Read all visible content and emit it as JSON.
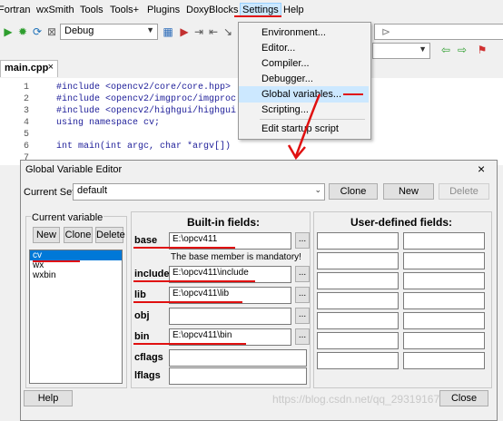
{
  "menubar": {
    "items": [
      "Fortran",
      "wxSmith",
      "Tools",
      "Tools+",
      "Plugins",
      "DoxyBlocks",
      "Settings",
      "Help"
    ]
  },
  "toolbar": {
    "build_target": "Debug"
  },
  "editor": {
    "tab_label": "main.cpp",
    "tab_close": "×",
    "line_numbers": [
      "1",
      "2",
      "3",
      "4",
      "5",
      "6",
      "7"
    ],
    "lines": [
      "#include <opencv2/core/core.hpp>",
      "#include <opencv2/imgproc/imgproc",
      "#include <opencv2/highgui/highgui",
      "using namespace cv;",
      "",
      "int main(int argc, char *argv[])",
      ""
    ]
  },
  "settings_menu": {
    "items": [
      "Environment...",
      "Editor...",
      "Compiler...",
      "Debugger...",
      "Global variables...",
      "Scripting...",
      "Edit startup script"
    ]
  },
  "dialog": {
    "title": "Global Variable Editor",
    "close": "×",
    "current_set_label": "Current Set:",
    "current_set_value": "default",
    "clone_set": "Clone",
    "new_set": "New",
    "delete_set": "Delete",
    "current_variable_label": "Current variable",
    "new_var": "New",
    "clone_var": "Clone",
    "delete_var": "Delete",
    "variables": [
      "cv",
      "wx",
      "wxbin"
    ],
    "builtin_header": "Built-in fields:",
    "userdef_header": "User-defined fields:",
    "base_label": "base",
    "base_value": "E:\\opcv411",
    "base_note": "The base member is mandatory!",
    "include_label": "include",
    "include_value": "E:\\opcv411\\include",
    "lib_label": "lib",
    "lib_value": "E:\\opcv411\\lib",
    "obj_label": "obj",
    "obj_value": "",
    "bin_label": "bin",
    "bin_value": "E:\\opcv411\\bin",
    "cflags_label": "cflags",
    "lflags_label": "lflags",
    "dots": "...",
    "help": "Help",
    "close_button": "Close"
  },
  "watermark": "https://blog.csdn.net/qq_29319167",
  "colors": {
    "selection": "#0078d7",
    "annotation": "#e01010",
    "menu_highlight": "#cce8ff"
  }
}
